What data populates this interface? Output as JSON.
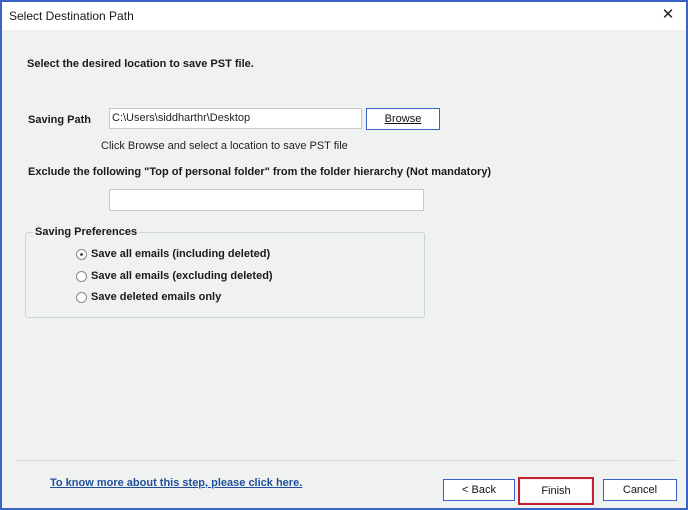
{
  "window": {
    "title": "Select Destination Path",
    "close_glyph": "✕"
  },
  "main": {
    "instruction": "Select the desired location to save PST file.",
    "saving_path_label": "Saving Path",
    "saving_path_value": "C:\\Users\\siddharthr\\Desktop",
    "browse_label": "Browse",
    "browse_hint": "Click Browse and select a location to save PST file",
    "exclude_label": "Exclude the following \"Top of personal folder\" from the folder hierarchy  (Not mandatory)",
    "exclude_value": ""
  },
  "preferences": {
    "title": "Saving Preferences",
    "options": [
      {
        "label": "Save all emails (including deleted)",
        "checked": true
      },
      {
        "label": "Save all emails (excluding deleted)",
        "checked": false
      },
      {
        "label": "Save deleted emails only",
        "checked": false
      }
    ]
  },
  "footer": {
    "help_link": "To know more about this step, please click here.",
    "back_label": "< Back",
    "finish_label": "Finish",
    "cancel_label": "Cancel"
  },
  "colors": {
    "window_border": "#3b63c4",
    "button_border": "#3b63c4",
    "highlight": "#c42032",
    "link": "#1f4f9c"
  }
}
